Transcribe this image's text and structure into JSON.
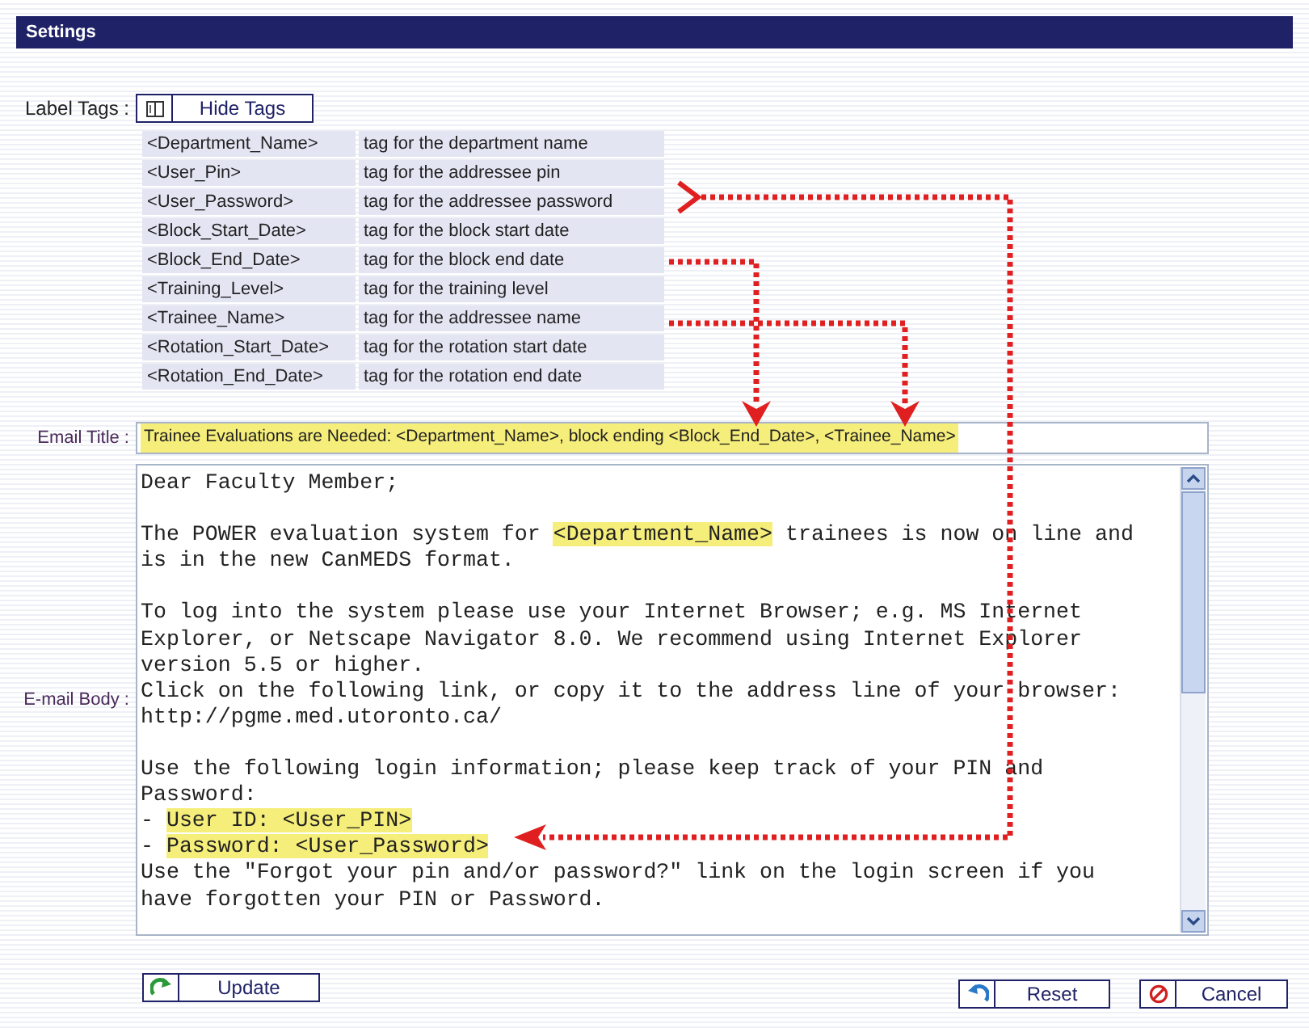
{
  "header": {
    "title": "Settings"
  },
  "label_tags": {
    "label": "Label Tags :",
    "button": "Hide Tags"
  },
  "tags": [
    {
      "tag": "<Department_Name>",
      "description": "tag for the department name"
    },
    {
      "tag": "<User_Pin>",
      "description": "tag for the addressee pin"
    },
    {
      "tag": "<User_Password>",
      "description": "tag for the addressee password"
    },
    {
      "tag": "<Block_Start_Date>",
      "description": "tag for the block start date"
    },
    {
      "tag": "<Block_End_Date>",
      "description": "tag for the block end date"
    },
    {
      "tag": "<Training_Level>",
      "description": "tag for the training level"
    },
    {
      "tag": "<Trainee_Name>",
      "description": "tag for the addressee name"
    },
    {
      "tag": "<Rotation_Start_Date>",
      "description": "tag for the rotation start date"
    },
    {
      "tag": "<Rotation_End_Date>",
      "description": "tag for the rotation end date"
    }
  ],
  "email_title": {
    "label": "Email Title :",
    "value": "Trainee Evaluations are Needed:  <Department_Name>, block ending <Block_End_Date>, <Trainee_Name>",
    "highlighted": true
  },
  "email_body": {
    "label": "E-mail Body :",
    "paragraphs": [
      [
        [
          {
            "text": "Dear Faculty Member;",
            "highlighted": false
          }
        ]
      ],
      [
        [
          {
            "text": "The POWER evaluation system for ",
            "highlighted": false
          },
          {
            "text": "<Department_Name>",
            "highlighted": true
          },
          {
            "text": " trainees is now on line and",
            "highlighted": false
          }
        ],
        [
          {
            "text": "is in the new CanMEDS format.",
            "highlighted": false
          }
        ]
      ],
      [
        [
          {
            "text": "To log into the system please use your Internet Browser; e.g. MS Internet",
            "highlighted": false
          }
        ],
        [
          {
            "text": "Explorer, or Netscape Navigator 8.0. We recommend using Internet Explorer",
            "highlighted": false
          }
        ],
        [
          {
            "text": "version 5.5 or higher.",
            "highlighted": false
          }
        ],
        [
          {
            "text": "Click on the following link, or copy it to the address line of your browser:",
            "highlighted": false
          }
        ],
        [
          {
            "text": "http://pgme.med.utoronto.ca/",
            "highlighted": false
          }
        ]
      ],
      [
        [
          {
            "text": "Use the following login information; please keep track of your PIN and",
            "highlighted": false
          }
        ],
        [
          {
            "text": "Password:",
            "highlighted": false
          }
        ],
        [
          {
            "text": "- ",
            "highlighted": false
          },
          {
            "text": "User ID: <User_PIN>",
            "highlighted": true
          }
        ],
        [
          {
            "text": "- ",
            "highlighted": false
          },
          {
            "text": "Password: <User_Password>",
            "highlighted": true
          }
        ],
        [
          {
            "text": "Use the \"Forgot your pin and/or password?\" link on the login screen if you",
            "highlighted": false
          }
        ],
        [
          {
            "text": "have forgotten your PIN or Password.",
            "highlighted": false
          }
        ]
      ]
    ]
  },
  "buttons": [
    {
      "kind": "update",
      "label": "Update"
    },
    {
      "kind": "reset",
      "label": "Reset"
    },
    {
      "kind": "cancel",
      "label": "Cancel"
    }
  ]
}
